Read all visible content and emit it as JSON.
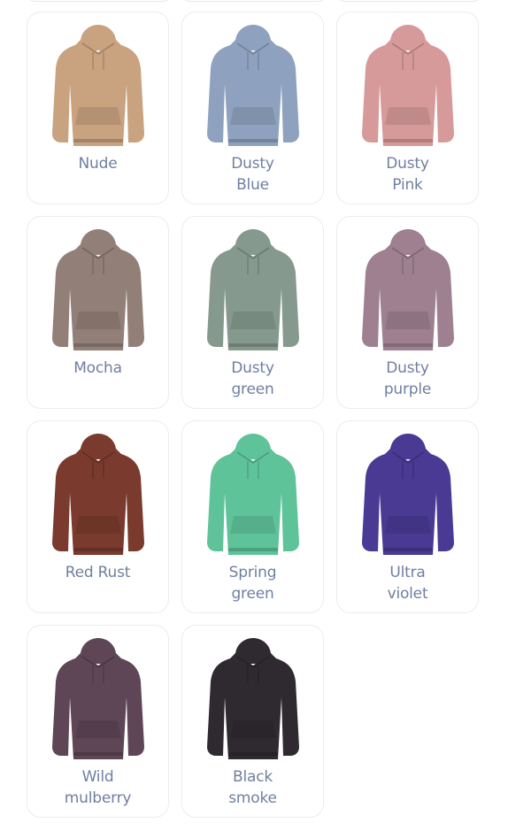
{
  "colors": [
    {
      "label": "Nude",
      "hex": "#c9a27f",
      "icon": "hoodie-icon"
    },
    {
      "label": "Dusty\nBlue",
      "hex": "#8ea2bf",
      "icon": "hoodie-icon"
    },
    {
      "label": "Dusty\nPink",
      "hex": "#d79a9a",
      "icon": "hoodie-icon"
    },
    {
      "label": "Mocha",
      "hex": "#927f77",
      "icon": "hoodie-icon"
    },
    {
      "label": "Dusty\ngreen",
      "hex": "#86998e",
      "icon": "hoodie-icon"
    },
    {
      "label": "Dusty\npurple",
      "hex": "#9e8090",
      "icon": "hoodie-icon"
    },
    {
      "label": "Red Rust",
      "hex": "#7a3a2d",
      "icon": "hoodie-icon"
    },
    {
      "label": "Spring\ngreen",
      "hex": "#5fc39a",
      "icon": "hoodie-icon"
    },
    {
      "label": "Ultra\nviolet",
      "hex": "#4a3a94",
      "icon": "hoodie-icon"
    },
    {
      "label": "Wild\nmulberry",
      "hex": "#5e4656",
      "icon": "hoodie-icon"
    },
    {
      "label": "Black\nsmoke",
      "hex": "#2f2a30",
      "icon": "hoodie-icon"
    }
  ]
}
